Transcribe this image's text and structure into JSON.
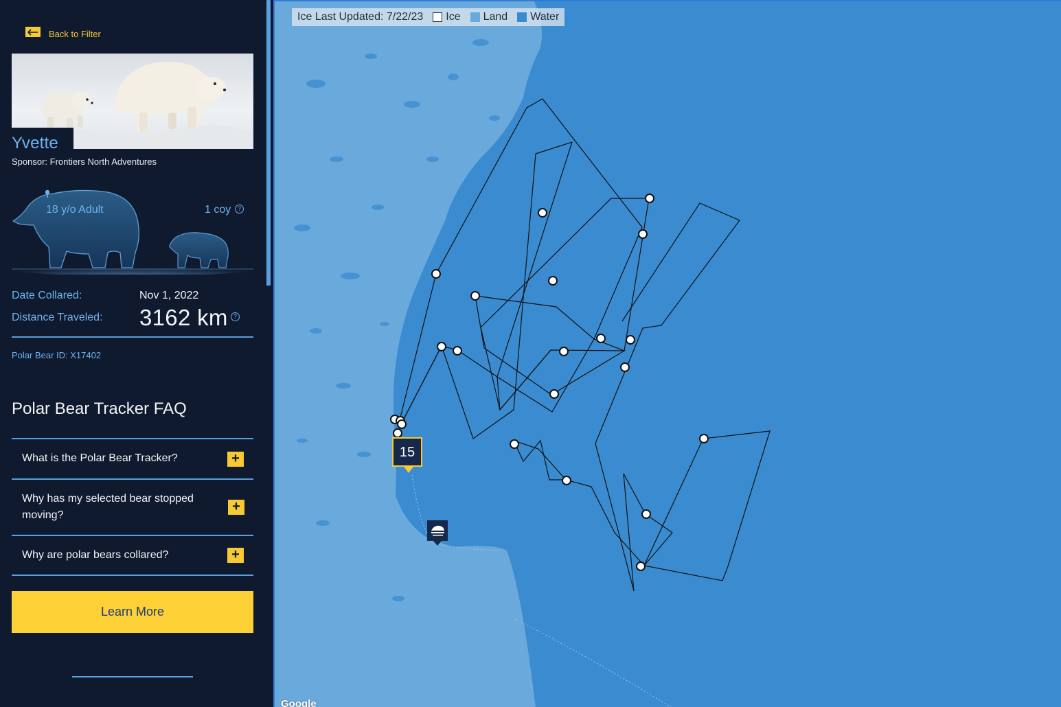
{
  "sidebar": {
    "back_label": "Back to Filter",
    "bear_name": "Yvette",
    "sponsor": "Sponsor: Frontiers North Adventures",
    "age": "18 y/o Adult",
    "coy": "1 coy",
    "help_glyph": "?",
    "date_collared_label": "Date Collared:",
    "date_collared_value": "Nov 1, 2022",
    "distance_label": "Distance Traveled:",
    "distance_value": "3162 km",
    "bear_id": "Polar Bear ID: X17402",
    "faq_title": "Polar Bear Tracker FAQ",
    "faq": [
      {
        "question": "What is the Polar Bear Tracker?"
      },
      {
        "question": "Why has my selected bear stopped moving?"
      },
      {
        "question": "Why are polar bears collared?"
      }
    ],
    "expand_glyph": "+",
    "learn_more": "Learn More"
  },
  "map": {
    "legend": {
      "updated": "Ice Last Updated: 7/22/23",
      "items": [
        "Ice",
        "Land",
        "Water"
      ]
    },
    "cluster_count": "15",
    "attribution": "Google"
  },
  "colors": {
    "background": "#0f1a2e",
    "accent": "#f7c933",
    "text_blue": "#6fb2ef",
    "water": "#3a8bd0",
    "land": "#6aa9dc",
    "ice": "#ffffff"
  },
  "icons": {
    "back": "arrow-left-icon",
    "help": "question-circle-icon",
    "expand": "plus-icon",
    "marker": "polar-bear-international-logo-icon"
  }
}
